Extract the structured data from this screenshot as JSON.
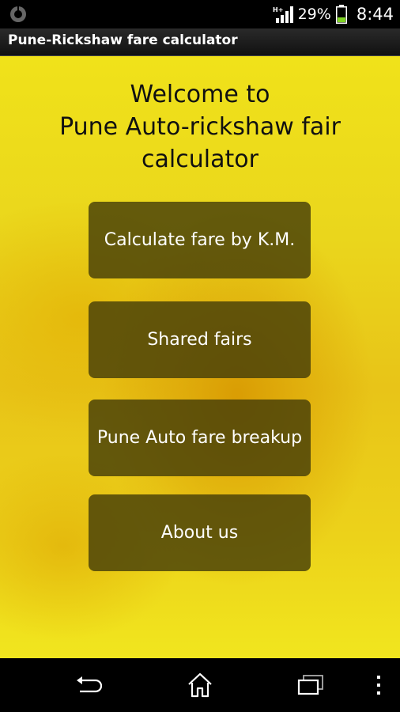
{
  "status_bar": {
    "network_label": "H+",
    "battery_percent": "29%",
    "time": "8:44",
    "icons": [
      "notification-app-icon",
      "signal-icon",
      "battery-icon"
    ]
  },
  "action_bar": {
    "title": "Pune-Rickshaw fare calculator"
  },
  "welcome": {
    "line1": "Welcome to",
    "line2": "Pune Auto-rickshaw fair",
    "line3": "calculator"
  },
  "menu": {
    "calculate_by_km": "Calculate fare by K.M.",
    "shared_fairs": "Shared fairs",
    "fare_breakup": "Pune Auto fare breakup",
    "about_us": "About us"
  },
  "nav_bar": {
    "icons": [
      "back-icon",
      "home-icon",
      "recent-apps-icon",
      "menu-overflow-icon"
    ]
  },
  "colors": {
    "background_yellow": "#ecd41c",
    "button_fill": "#463e08",
    "bar_black": "#000000"
  }
}
